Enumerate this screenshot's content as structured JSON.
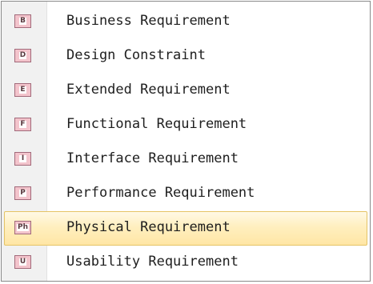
{
  "menu": {
    "items": [
      {
        "icon_text": "B",
        "icon_name": "business-requirement-icon",
        "label": "Business Requirement",
        "highlighted": false
      },
      {
        "icon_text": "D",
        "icon_name": "design-constraint-icon",
        "label": "Design Constraint",
        "highlighted": false
      },
      {
        "icon_text": "E",
        "icon_name": "extended-requirement-icon",
        "label": "Extended Requirement",
        "highlighted": false
      },
      {
        "icon_text": "F",
        "icon_name": "functional-requirement-icon",
        "label": "Functional Requirement",
        "highlighted": false
      },
      {
        "icon_text": "I",
        "icon_name": "interface-requirement-icon",
        "label": "Interface Requirement",
        "highlighted": false
      },
      {
        "icon_text": "P",
        "icon_name": "performance-requirement-icon",
        "label": "Performance Requirement",
        "highlighted": false
      },
      {
        "icon_text": "Ph",
        "icon_name": "physical-requirement-icon",
        "label": "Physical Requirement",
        "highlighted": true
      },
      {
        "icon_text": "U",
        "icon_name": "usability-requirement-icon",
        "label": "Usability Requirement",
        "highlighted": false
      }
    ],
    "colors": {
      "icon_fill": "#f3c4cc",
      "icon_border": "#a26a7a",
      "highlight": "#ffefbf",
      "highlight_border": "#e5c365"
    }
  }
}
